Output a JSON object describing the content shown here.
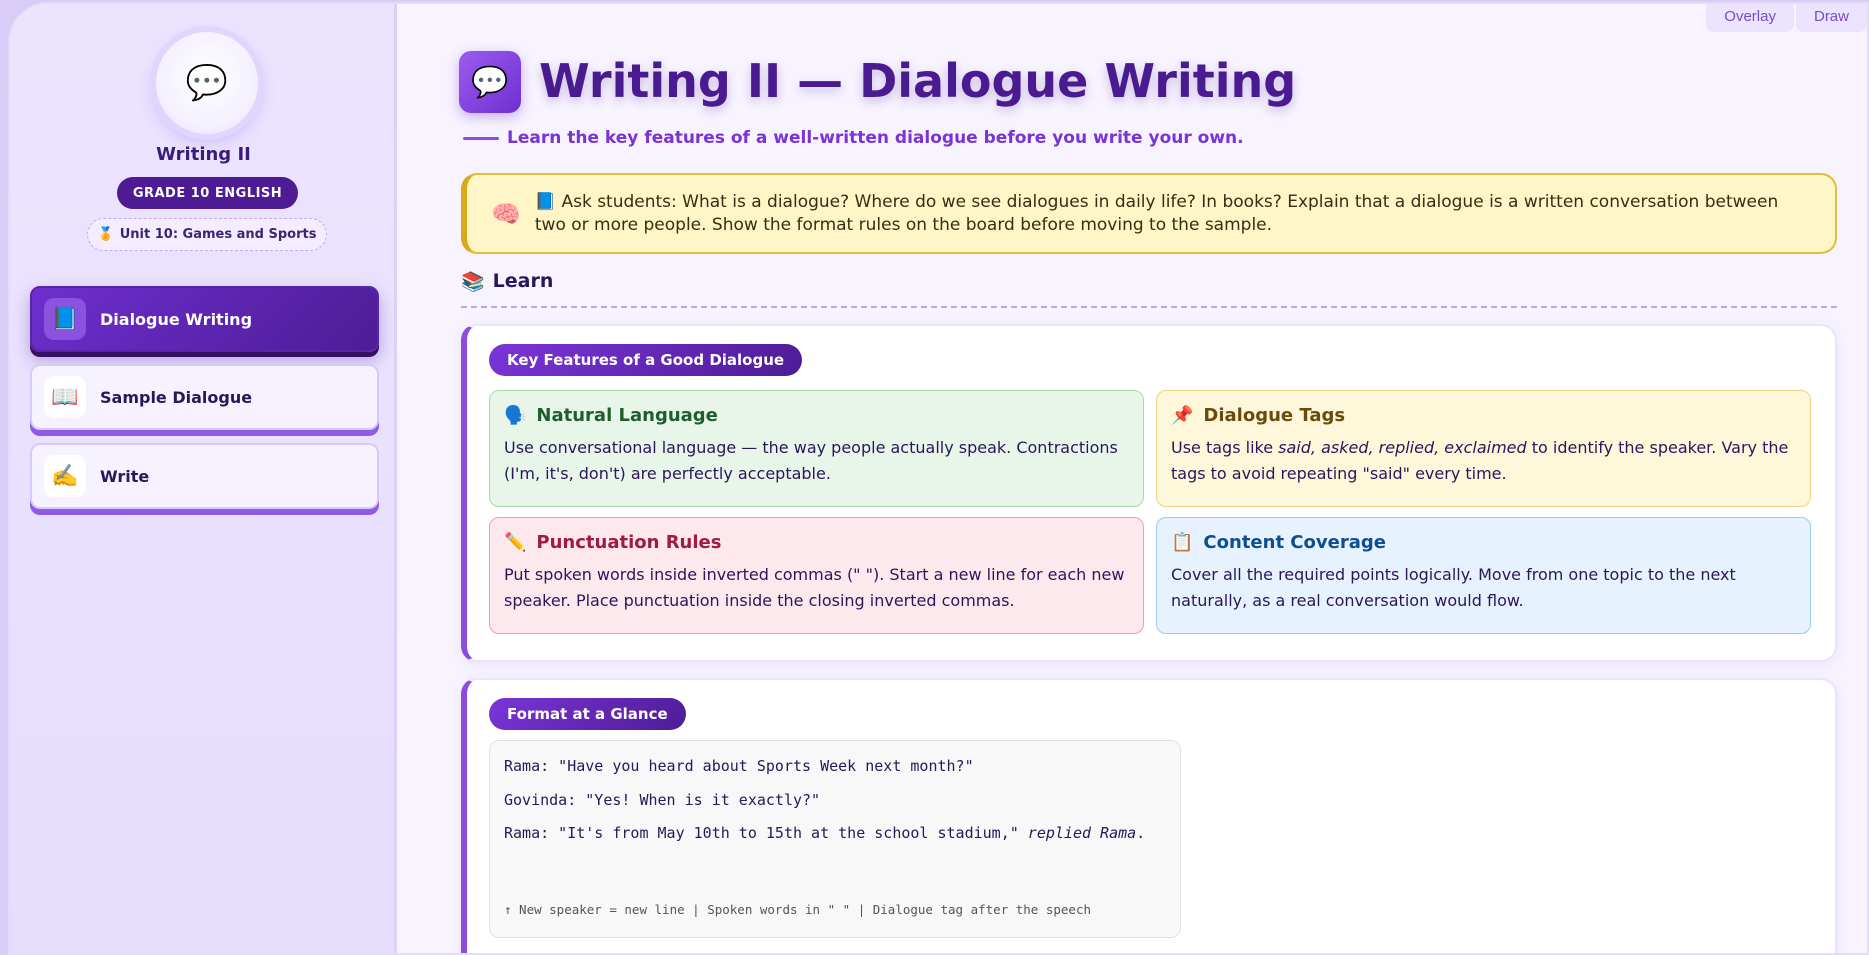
{
  "top_tabs": [
    "Overlay",
    "Draw"
  ],
  "sidebar": {
    "avatar_icon": "speech-bubble-icon",
    "title": "Writing II",
    "grade": "GRADE 10 ENGLISH",
    "unit_icon": "🏅",
    "unit": "Unit 10: Games and Sports",
    "items": [
      {
        "icon": "📘",
        "label": "Dialogue Writing",
        "active": true
      },
      {
        "icon": "📖",
        "label": "Sample Dialogue",
        "active": false
      },
      {
        "icon": "✍️",
        "label": "Write",
        "active": false
      }
    ]
  },
  "main": {
    "title_icon": "💬",
    "title": "Writing II — Dialogue Writing",
    "subtitle": "Learn the key features of a well-written dialogue before you write your own.",
    "note": {
      "icon": "🧠",
      "text": "📘 Ask students: What is a dialogue? Where do we see dialogues in daily life? In books? Explain that a dialogue is a written conversation between two or more people. Show the format rules on the board before moving to the sample."
    },
    "section": {
      "icon": "📚",
      "label": "Learn"
    },
    "features_card": {
      "title": "Key Features of a Good Dialogue",
      "features": [
        {
          "icon": "🗣️",
          "title": "Natural Language",
          "body": "Use conversational language — the way people actually speak. Contractions (I'm, it's, don't) are perfectly acceptable."
        },
        {
          "icon": "📌",
          "title": "Dialogue Tags",
          "body_prefix": "Use tags like ",
          "body_tags": "said, asked, replied, exclaimed",
          "body_suffix": " to identify the speaker. Vary the tags to avoid repeating \"said\" every time."
        },
        {
          "icon": "✏️",
          "title": "Punctuation Rules",
          "body": "Put spoken words inside inverted commas (\" \"). Start a new line for each new speaker. Place punctuation inside the closing inverted commas."
        },
        {
          "icon": "📋",
          "title": "Content Coverage",
          "body": "Cover all the required points logically. Move from one topic to the next naturally, as a real conversation would flow."
        }
      ]
    },
    "format_card": {
      "title": "Format at a Glance",
      "lines": [
        {
          "text": "Rama: \"Have you heard about Sports Week next month?\"",
          "tag": ""
        },
        {
          "text": "Govinda: \"Yes! When is it exactly?\"",
          "tag": ""
        },
        {
          "text": "Rama: \"It's from May 10th to 15th at the school stadium,\" ",
          "tag": "replied Rama",
          "end": "."
        }
      ],
      "footer": "↑ New speaker = new line  |  Spoken words in \" \"  |  Dialogue tag after the speech"
    }
  }
}
